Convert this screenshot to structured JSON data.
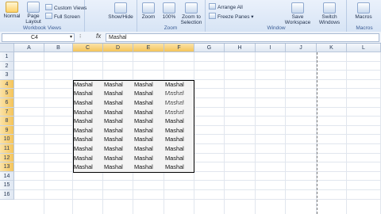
{
  "ribbon": {
    "workbook_views": {
      "normal": "Normal",
      "page_layout": "Page Layout",
      "custom_views": "Custom Views",
      "full_screen": "Full Screen",
      "group_label": "Workbook Views"
    },
    "show_hide": "Show/Hide",
    "zoom": {
      "zoom": "Zoom",
      "pct": "100%",
      "zoom_selection": "Zoom to Selection",
      "group_label": "Zoom"
    },
    "window": {
      "arrange_all": "Arrange All",
      "freeze_panes": "Freeze Panes",
      "save_workspace": "Save Workspace",
      "switch_windows": "Switch Windows",
      "group_label": "Window"
    },
    "macros": {
      "macros": "Macros",
      "group_label": "Macros"
    }
  },
  "formula_bar": {
    "name_box": "C4",
    "fx": "fx",
    "value": "Mashal"
  },
  "columns": [
    "A",
    "B",
    "C",
    "D",
    "E",
    "F",
    "G",
    "H",
    "I",
    "J",
    "K",
    "L"
  ],
  "rows": [
    "1",
    "2",
    "3",
    "4",
    "5",
    "6",
    "7",
    "8",
    "9",
    "10",
    "11",
    "12",
    "13",
    "14",
    "15",
    "16"
  ],
  "cell_text": "Mashal",
  "ghost_text": "Mashal"
}
